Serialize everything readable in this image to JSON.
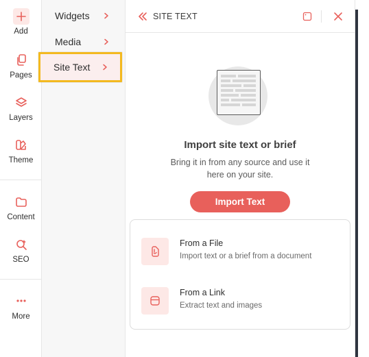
{
  "rail": {
    "items": [
      {
        "label": "Add",
        "icon": "plus-icon"
      },
      {
        "label": "Pages",
        "icon": "pages-icon"
      },
      {
        "label": "Layers",
        "icon": "layers-icon"
      },
      {
        "label": "Theme",
        "icon": "theme-icon"
      },
      {
        "label": "Content",
        "icon": "folder-icon"
      },
      {
        "label": "SEO",
        "icon": "seo-icon"
      },
      {
        "label": "More",
        "icon": "more-icon"
      }
    ]
  },
  "submenu": {
    "items": [
      {
        "label": "Widgets"
      },
      {
        "label": "Media"
      },
      {
        "label": "Site Text",
        "active": true
      }
    ]
  },
  "panel": {
    "title": "SITE TEXT",
    "empty_title": "Import site text or brief",
    "empty_desc": "Bring it in from any source and use it here on your site.",
    "import_button": "Import Text",
    "options": [
      {
        "title": "From a File",
        "desc": "Import text or a brief from a document",
        "icon": "file-upload-icon"
      },
      {
        "title": "From a Link",
        "desc": "Extract text and images",
        "icon": "link-window-icon"
      }
    ]
  },
  "colors": {
    "accent": "#e8605b",
    "accent_soft": "#fde8e6",
    "highlight": "#f3b91f"
  }
}
